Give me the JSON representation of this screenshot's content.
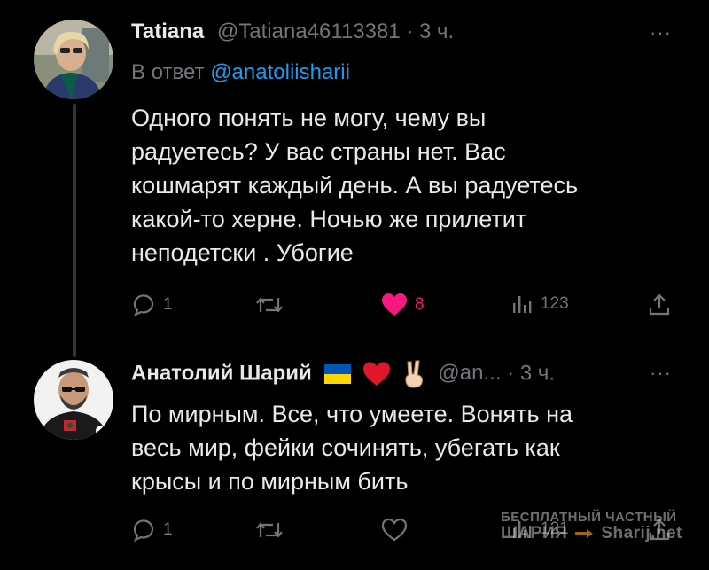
{
  "tweet1": {
    "name": "Tatiana",
    "handle": "@Tatiana46113381",
    "separator": "·",
    "time": "3 ч.",
    "more": "···",
    "reply_prefix": "В ответ",
    "reply_mention": "@anatoliisharii",
    "lines": [
      "Одного понять не могу, чему вы",
      "радуетесь? У вас страны нет. Вас",
      "кошмарят каждый день. А вы радуетесь",
      "какой-то херне. Ночью же прилетит",
      "неподетски . Убогие"
    ],
    "actions": {
      "replies": "1",
      "likes": "8",
      "views": "123"
    },
    "colors": {
      "like": "#f91880"
    }
  },
  "tweet2": {
    "name": "Анатолий Шарий",
    "name_icons": [
      "ukraine-flag-icon",
      "red-heart-icon",
      "victory-hand-icon"
    ],
    "handle": "@an...",
    "separator": "·",
    "time": "3 ч.",
    "more": "···",
    "lines": [
      "По мирным. Все, что умеете. Вонять на",
      "весь мир, фейки сочинять, убегать как",
      "крысы и по мирным бить"
    ],
    "actions": {
      "replies": "1",
      "views": "121"
    }
  },
  "watermark": {
    "line1": "БЕСПЛАТНЫЙ ЧАСТНЫЙ",
    "line2a": "ШАРИЯ",
    "line2b": "Sharij.net"
  },
  "colors": {
    "background": "#000000",
    "text": "#e7e9ea",
    "muted": "#71767b",
    "link": "#1d9bf0"
  }
}
